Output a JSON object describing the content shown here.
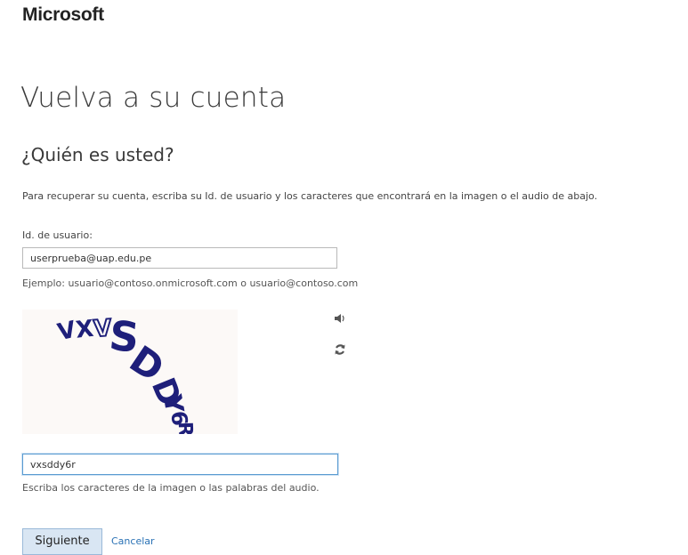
{
  "header": {
    "logo_text": "Microsoft"
  },
  "page": {
    "title": "Vuelva a su cuenta",
    "subtitle": "¿Quién es usted?",
    "intro": "Para recuperar su cuenta, escriba su Id. de usuario y los caracteres que encontrará en la imagen o el audio de abajo."
  },
  "userid": {
    "label": "Id. de usuario:",
    "value": "userprueba@uap.edu.pe",
    "example": "Ejemplo: usuario@contoso.onmicrosoft.com o usuario@contoso.com"
  },
  "captcha": {
    "characters": "VXSDDY6R",
    "audio_icon": "speaker-icon",
    "refresh_icon": "refresh-icon",
    "input_value": "vxsddy6r",
    "hint": "Escriba los caracteres de la imagen o las palabras del audio."
  },
  "actions": {
    "next_label": "Siguiente",
    "cancel_label": "Cancelar"
  },
  "colors": {
    "link": "#2a72b5",
    "button_bg": "#d9e6f3",
    "input_focus_border": "#5a9bd1",
    "captcha_text": "#1e1f7a"
  }
}
